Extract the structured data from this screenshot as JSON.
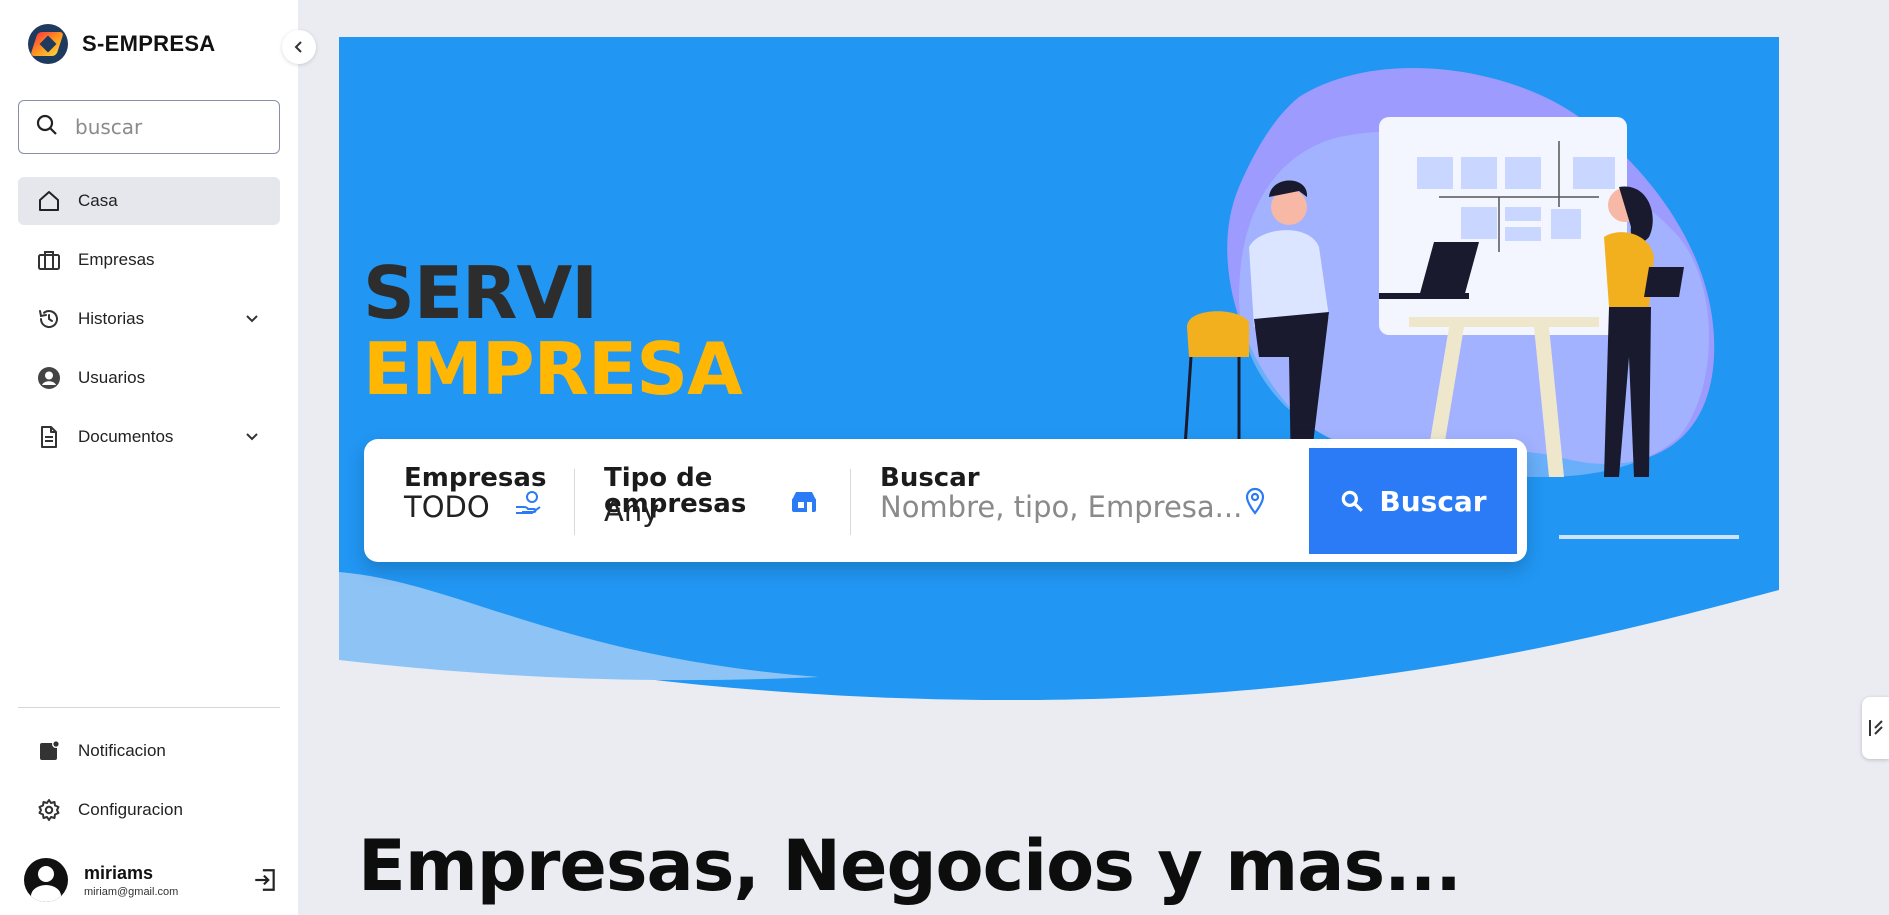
{
  "brand": {
    "name": "S-EMPRESA"
  },
  "search": {
    "placeholder": "buscar"
  },
  "nav": {
    "items": [
      {
        "label": "Casa",
        "icon": "home-icon",
        "active": true
      },
      {
        "label": "Empresas",
        "icon": "briefcase-icon"
      },
      {
        "label": "Historias",
        "icon": "history-icon",
        "expandable": true
      },
      {
        "label": "Usuarios",
        "icon": "user-circle-icon"
      },
      {
        "label": "Documentos",
        "icon": "document-icon",
        "expandable": true
      }
    ]
  },
  "bottom_nav": {
    "items": [
      {
        "label": "Notificacion",
        "icon": "notification-icon"
      },
      {
        "label": "Configuracion",
        "icon": "gear-icon"
      }
    ]
  },
  "user": {
    "name": "miriams",
    "email": "miriam@gmail.com"
  },
  "hero": {
    "title_line1": "SERVI",
    "title_line2": "EMPRESA",
    "colors": {
      "background": "#2196F3",
      "title_dark": "#2d2d2d",
      "title_accent": "#FFB703"
    }
  },
  "search_card": {
    "field1": {
      "label": "Empresas",
      "value": "TODO",
      "icon": "hand-coin-icon"
    },
    "field2": {
      "label": "Tipo de empresas",
      "value": "Any",
      "icon": "store-icon"
    },
    "field3": {
      "label": "Buscar",
      "placeholder": "Nombre, tipo, Empresa...",
      "icon": "location-pin-icon"
    },
    "button": {
      "label": "Buscar",
      "icon": "search-icon",
      "color": "#2B7BF6"
    }
  },
  "section": {
    "title": "Empresas, Negocios y mas..."
  }
}
